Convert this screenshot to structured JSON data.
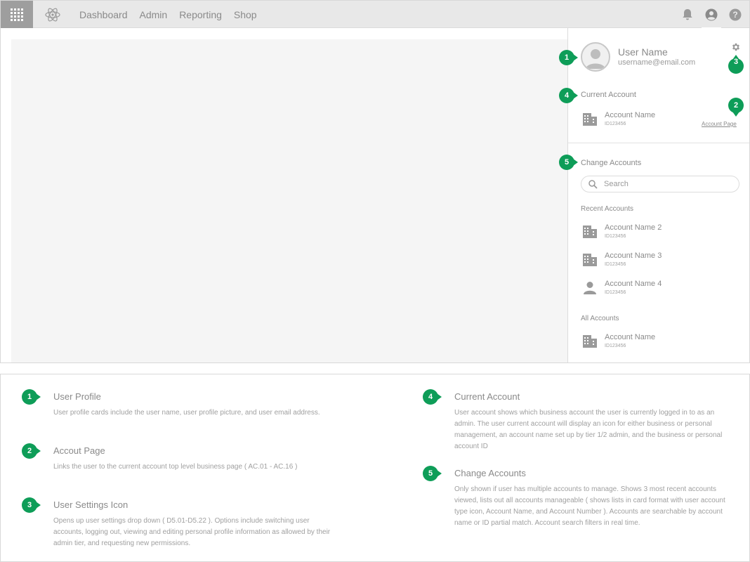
{
  "nav": {
    "items": [
      "Dashboard",
      "Admin",
      "Reporting",
      "Shop"
    ]
  },
  "icons": {
    "apps": "apps-grid-icon",
    "logo": "atom-logo-icon",
    "notifications": "bell-icon",
    "account": "account-circle-icon",
    "help": "help-icon",
    "settings": "gear-icon",
    "search": "search-icon",
    "business": "building-icon",
    "personal": "person-icon"
  },
  "colors": {
    "marker": "#0e9d58",
    "topbar": "#e8e8e8",
    "apps_button": "#9e9e9e",
    "canvas": "#f5f5f5"
  },
  "profile": {
    "name": "User Name",
    "email": "username@email.com"
  },
  "current_account": {
    "title": "Current Account",
    "name": "Account Name",
    "id": "ID123456",
    "link": "Account Page"
  },
  "change_accounts": {
    "title": "Change Accounts",
    "search_placeholder": "Search",
    "recent_title": "Recent Accounts",
    "recent": [
      {
        "name": "Account Name 2",
        "id": "ID123456",
        "type": "business"
      },
      {
        "name": "Account Name 3",
        "id": "ID123456",
        "type": "business"
      },
      {
        "name": "Account Name 4",
        "id": "ID123456",
        "type": "personal"
      }
    ],
    "all_title": "All Accounts",
    "all": [
      {
        "name": "Account Name",
        "id": "ID123456",
        "type": "business"
      }
    ]
  },
  "markers": [
    "1",
    "2",
    "3",
    "4",
    "5"
  ],
  "legend": {
    "items": [
      {
        "number": "1",
        "title": "User Profile",
        "text": "User profile cards include the user name, user profile picture, and user email address."
      },
      {
        "number": "2",
        "title": "Accout Page",
        "text": "Links the user to the current account top level business page ( AC.01 - AC.16 )"
      },
      {
        "number": "3",
        "title": "User Settings Icon",
        "text": "Opens up user settings drop down ( D5.01-D5.22 ).  Options include switching user accounts, logging out, viewing and editing personal profile information as allowed by their admin tier, and requesting new permissions."
      },
      {
        "number": "4",
        "title": "Current Account",
        "text": "User account shows which business account the user is currently logged in to as an admin.  The user current account will display an icon for either business or personal management, an account name set up by tier 1/2 admin, and the business or personal account ID"
      },
      {
        "number": "5",
        "title": "Change Accounts",
        "text": "Only shown if user has multiple accounts to manage.  Shows 3 most recent accounts viewed, lists out all accounts manageable ( shows lists in card format with user account type icon, Account Name, and Account Number ).  Accounts are searchable by account name or ID partial match.  Account search filters in real time."
      }
    ]
  }
}
